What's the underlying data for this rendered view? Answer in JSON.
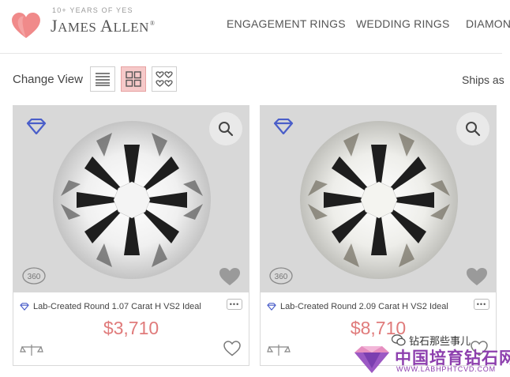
{
  "brand": {
    "tagline": "10+ YEARS OF YES",
    "name_first": "J",
    "name_first_rest": "AMES ",
    "name_last": "A",
    "name_last_rest": "LLEN",
    "reg_mark": "®",
    "accent_color": "#f08a8a"
  },
  "nav": {
    "items": [
      {
        "label": "ENGAGEMENT RINGS"
      },
      {
        "label": "WEDDING RINGS"
      },
      {
        "label": "DIAMON"
      }
    ]
  },
  "toolbar": {
    "change_view_label": "Change View",
    "views": [
      {
        "icon": "list-view-icon",
        "active": false
      },
      {
        "icon": "grid-view-icon",
        "active": true
      },
      {
        "icon": "hearts-view-icon",
        "active": false
      }
    ],
    "ships_label": "Ships as"
  },
  "products": [
    {
      "title": "Lab-Created Round 1.07 Carat H VS2 Ideal",
      "price": "$3,710",
      "more_label": "•••"
    },
    {
      "title": "Lab-Created Round 2.09 Carat H VS2 Ideal",
      "price": "$8,710",
      "more_label": "•••"
    }
  ],
  "icons": {
    "badge": "diamond-outline-icon",
    "zoom": "magnifier-icon",
    "rotate": "360-view-icon",
    "compare": "compare-icon",
    "wishlist": "heart-icon"
  },
  "colors": {
    "price": "#e07b7b",
    "badge_blue": "#4a5ec9",
    "active_view": "#f6c9c9"
  },
  "watermark": {
    "wechat_label": "钻石那些事儿",
    "site_name": "中国培育钻石网",
    "site_url": "WWW.LABHPHTCVD.COM"
  }
}
